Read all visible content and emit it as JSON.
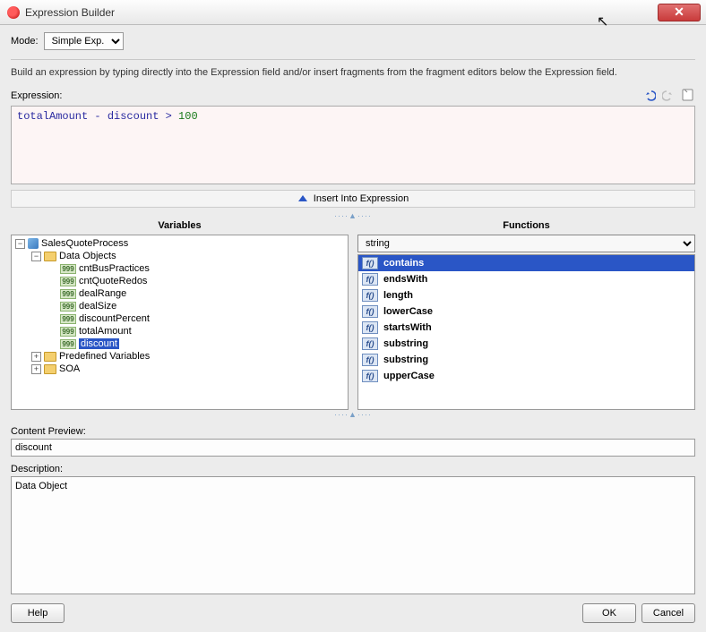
{
  "window": {
    "title": "Expression Builder",
    "close_tooltip": "Close"
  },
  "mode": {
    "label": "Mode:",
    "selected": "Simple Exp."
  },
  "instruction": "Build an expression by typing directly into the Expression field and/or insert fragments from the fragment editors below the Expression field.",
  "expression": {
    "label": "Expression:",
    "tokens": {
      "a": "totalAmount",
      "op1": "-",
      "b": "discount",
      "op2": ">",
      "c": "100"
    },
    "undo_tip": "Undo",
    "redo_tip": "Redo",
    "clear_tip": "Clear"
  },
  "insert_button": "Insert Into Expression",
  "variables": {
    "title": "Variables",
    "root": "SalesQuoteProcess",
    "data_objects_label": "Data Objects",
    "items": [
      "cntBusPractices",
      "cntQuoteRedos",
      "dealRange",
      "dealSize",
      "discountPercent",
      "totalAmount",
      "discount"
    ],
    "selected": "discount",
    "predef_label": "Predefined Variables",
    "soa_label": "SOA"
  },
  "functions": {
    "title": "Functions",
    "category": "string",
    "items": [
      "contains",
      "endsWith",
      "length",
      "lowerCase",
      "startsWith",
      "substring",
      "substring",
      "upperCase"
    ],
    "selected_index": 0
  },
  "content_preview": {
    "label": "Content Preview:",
    "value": "discount"
  },
  "description": {
    "label": "Description:",
    "value": "Data Object"
  },
  "buttons": {
    "help": "Help",
    "ok": "OK",
    "cancel": "Cancel"
  }
}
